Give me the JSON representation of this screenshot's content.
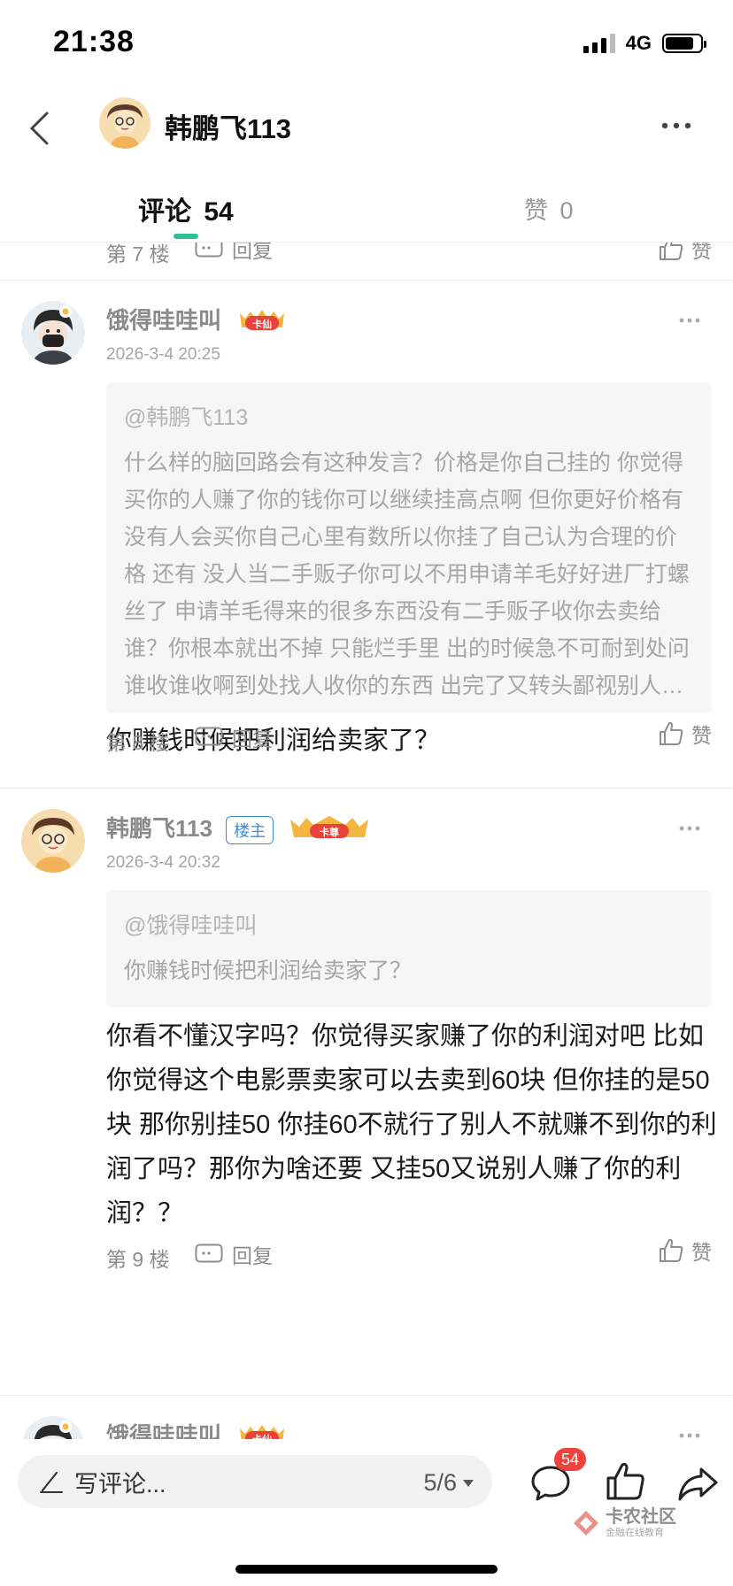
{
  "status_bar": {
    "time": "21:38",
    "network": "4G"
  },
  "header": {
    "title": "韩鹏飞113"
  },
  "tabs": {
    "comments_label": "评论",
    "comments_count": "54",
    "likes_label": "赞",
    "likes_count": "0"
  },
  "partial_prev": {
    "floor": "第 7 楼",
    "reply": "回复",
    "like": "赞"
  },
  "comments": [
    {
      "author": "饿得哇哇叫",
      "badge_card": "卡仙",
      "time": "2026-3-4 20:25",
      "quote_at": "@韩鹏飞113",
      "quote_text": "什么样的脑回路会有这种发言？价格是你自己挂的 你觉得买你的人赚了你的钱你可以继续挂高点啊 但你更好价格有没有人会买你自己心里有数所以你挂了自己认为合理的价格 还有 没人当二手贩子你可以不用申请羊毛好好进厂打螺丝了 申请羊毛得来的很多东西没有二手贩子收你去卖给谁？你根本就出不掉 只能烂手里 出的时候急不可耐到处问谁收谁收啊到处找人收你的东西 出完了又转头鄙视别人二道贩子",
      "body": "你赚钱时候把利润给卖家了？",
      "floor": "第 8 楼",
      "reply": "回复",
      "like": "赞"
    },
    {
      "author": "韩鹏飞113",
      "badge_host": "楼主",
      "badge_card": "卡尊",
      "time": "2026-3-4 20:32",
      "quote_at": "@饿得哇哇叫",
      "quote_text": "你赚钱时候把利润给卖家了？",
      "body": "你看不懂汉字吗？你觉得买家赚了你的利润对吧 比如你觉得这个电影票卖家可以去卖到60块 但你挂的是50块 那你别挂50 你挂60不就行了别人不就赚不到你的利润了吗？那你为啥还要 又挂50又说别人赚了你的利润？？",
      "floor": "第 9 楼",
      "reply": "回复",
      "like": "赞"
    },
    {
      "author": "饿得哇哇叫",
      "badge_card": "卡仙"
    }
  ],
  "bottom_bar": {
    "input_placeholder": "写评论...",
    "pager": "5/6",
    "comment_count": "54",
    "watermark_main": "卡农社区",
    "watermark_sub": "金融在线教育"
  },
  "colors": {
    "accent": "#2dbf9a",
    "badge_red": "#f0423c",
    "host_blue": "#3b8be0"
  }
}
